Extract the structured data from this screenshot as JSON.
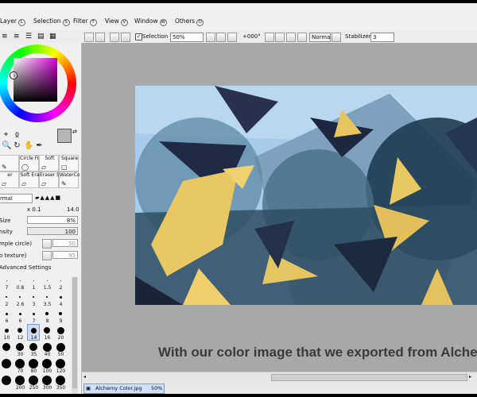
{
  "menu": {
    "items": [
      {
        "label": "Layer",
        "key": "L"
      },
      {
        "label": "Selection",
        "key": "S"
      },
      {
        "label": "Filter",
        "key": "T"
      },
      {
        "label": "View",
        "key": "V"
      },
      {
        "label": "Window",
        "key": "W"
      },
      {
        "label": "Others",
        "key": "O"
      }
    ]
  },
  "toolbar": {
    "selection_label": "Selection",
    "selection_checked": "✓",
    "zoom_value": "50%",
    "rotation_value": "+000°",
    "blend_mode": "Normal",
    "stabilizer_label": "Stabilizer",
    "stabilizer_value": "3"
  },
  "tools": {
    "brushes": [
      {
        "label": "",
        "icon": "✎"
      },
      {
        "label": "Circle Fi.",
        "icon": "◯"
      },
      {
        "label": "Soft",
        "icon": "▱"
      },
      {
        "label": "Square",
        "icon": "▢"
      },
      {
        "label": "er",
        "icon": "▱"
      },
      {
        "label": "Soft Era",
        "icon": "▱"
      },
      {
        "label": "Eraser Squa",
        "icon": "▱"
      },
      {
        "label": "WaterCo",
        "icon": "✎"
      }
    ]
  },
  "brush_settings": {
    "blend_mode": "rmal",
    "multiplier": "x 0.1",
    "max_size": "14.0",
    "size_label": "Size",
    "size_value": "8%",
    "density_label": "nsity",
    "density_value": "100",
    "shape_label": "mple circle)",
    "shape_value": "50",
    "texture_label": "o texture)",
    "texture_value": "95",
    "advanced_label": "Advanced Settings"
  },
  "size_presets": {
    "rows": [
      [
        "7",
        "0.8",
        "1",
        "1.5",
        "2"
      ],
      [
        "2",
        "2.6",
        "3",
        "3.5",
        "4"
      ],
      [
        "6",
        "6",
        "7",
        "8",
        "9"
      ],
      [
        "10",
        "12",
        "14",
        "16",
        "20"
      ],
      [
        "",
        "30",
        "35",
        "40",
        "50"
      ],
      [
        "",
        "70",
        "80",
        "100",
        "120"
      ],
      [
        "",
        "200",
        "250",
        "300",
        "350"
      ]
    ]
  },
  "canvas": {
    "caption": "With our color image that we exported from Alchemy."
  },
  "status": {
    "doc_name": "Alchemy Color.jpg",
    "doc_zoom": "50%"
  },
  "colors": {
    "accent": "#7d9bd4",
    "canvas_bg": "#a8a8a8",
    "art_sky": "#9ec3e3",
    "art_yellow": "#e8c863",
    "art_navy": "#1f2a44"
  }
}
